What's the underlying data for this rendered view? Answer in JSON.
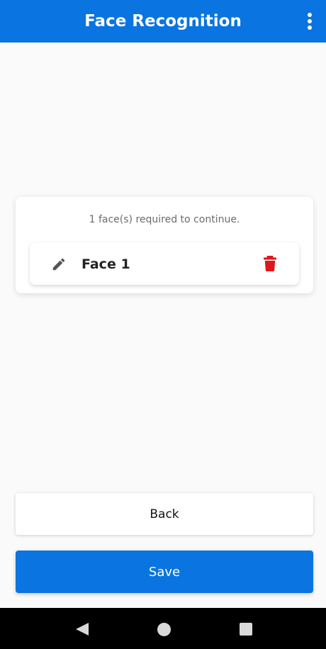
{
  "app_bar": {
    "title": "Face Recognition",
    "menu_icon": "more-vert-icon",
    "background": "#0a74e0"
  },
  "faces_card": {
    "required_text": "1 face(s) required to continue.",
    "faces": [
      {
        "name": "Face 1",
        "edit_icon": "pencil-icon",
        "delete_icon": "trash-icon",
        "delete_color": "#e0161b"
      }
    ]
  },
  "actions": {
    "back_label": "Back",
    "save_label": "Save",
    "save_color": "#0a74e0"
  },
  "system_nav": {
    "back_icon": "nav-back-icon",
    "home_icon": "nav-home-icon",
    "recent_icon": "nav-recent-apps-icon"
  }
}
